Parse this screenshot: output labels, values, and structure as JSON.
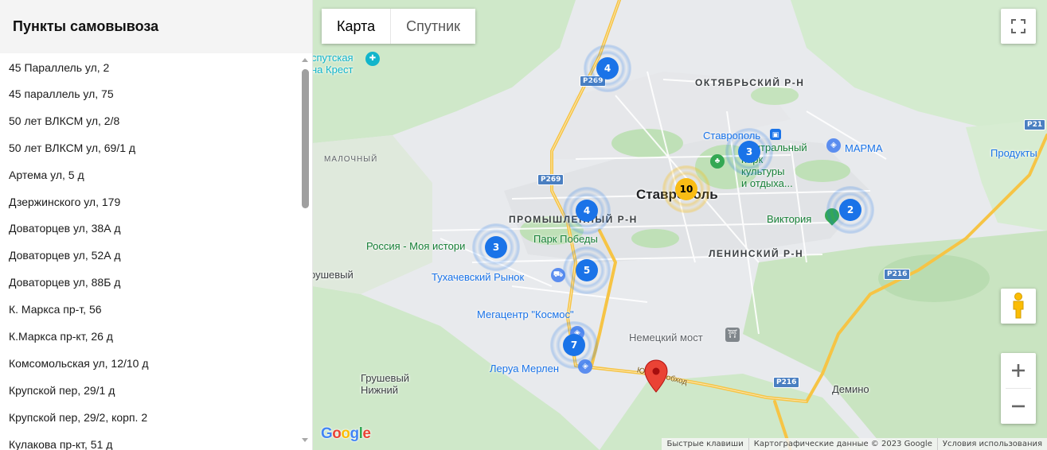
{
  "sidebar": {
    "title": "Пункты самовывоза",
    "addresses": [
      "45 Параллель ул, 2",
      "45 параллель ул, 75",
      "50 лет ВЛКСМ ул, 2/8",
      "50 лет ВЛКСМ ул, 69/1 д",
      "Артема ул, 5 д",
      "Дзержинского ул, 179",
      "Доваторцев ул, 38А д",
      "Доваторцев ул, 52А д",
      "Доваторцев ул, 88Б д",
      "К. Маркса пр-т, 56",
      "К.Маркса пр-кт, 26 д",
      "Комсомольская ул, 12/10 д",
      "Крупской пер, 29/1 д",
      "Крупской пер, 29/2, корп. 2",
      "Кулакова пр-кт, 51 д"
    ]
  },
  "map": {
    "type_buttons": {
      "map": "Карта",
      "satellite": "Спутник"
    },
    "labels": {
      "oktyabrsky": "ОКТЯБРЬСКИЙ Р-Н",
      "promyshlenny": "ПРОМЫШЛЕННЫЙ Р-Н",
      "leninsky": "ЛЕНИНСКИЙ Р-Н",
      "malochny": "МАЛОЧНЫЙ",
      "city": "Ставрополь",
      "grushevy": "рушевый",
      "grushevy_nizhny": "Грушевый\nНижний",
      "demino": "Демино",
      "red_cross": "спутская\nна Крест",
      "stavropol_station": "Ставрополь",
      "central_park": "Центральный\nпарк\nкультуры\nи отдыха...",
      "marma": "МАРМА",
      "products": "Продукты",
      "viktoria": "Виктория",
      "park_pobedy": "Парк Победы",
      "russia_history": "Россия - Моя истори",
      "tukhachevsky": "Тухачевский Рынок",
      "kosmos": "Мегацентр \"Космос\"",
      "nemetsky_most": "Немецкий мост",
      "leroy": "Леруа Мерлен",
      "bypass": "Южный обход"
    },
    "road_shields": [
      "P269",
      "P269",
      "P216",
      "P216",
      "P21"
    ],
    "clusters": [
      {
        "count": "4",
        "color": "blue"
      },
      {
        "count": "3",
        "color": "blue"
      },
      {
        "count": "10",
        "color": "yellow"
      },
      {
        "count": "4",
        "color": "blue"
      },
      {
        "count": "2",
        "color": "blue"
      },
      {
        "count": "3",
        "color": "blue"
      },
      {
        "count": "5",
        "color": "blue"
      },
      {
        "count": "7",
        "color": "blue"
      }
    ],
    "google_logo": "Google",
    "attribution": {
      "shortcuts": "Быстрые клавиши",
      "data": "Картографические данные © 2023 Google",
      "terms": "Условия использования"
    },
    "colors": {
      "cluster_blue": "#1a73e8",
      "cluster_yellow": "#f9bc15",
      "pin_red": "#ea4335",
      "park_green": "#c6e6c1"
    }
  }
}
